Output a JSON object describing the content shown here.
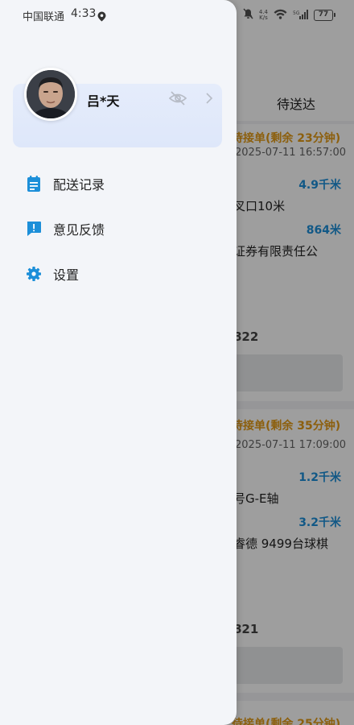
{
  "status_bar": {
    "carrier": "中国联通",
    "time": "4:33",
    "net_speed_top": "4.4",
    "net_speed_bottom": "K/s",
    "battery": "77"
  },
  "profile": {
    "name": "吕*天"
  },
  "menu": {
    "items": [
      {
        "label": "配送记录",
        "icon": "delivery-record-icon"
      },
      {
        "label": "意见反馈",
        "icon": "feedback-icon"
      },
      {
        "label": "设置",
        "icon": "settings-icon"
      }
    ]
  },
  "background": {
    "tab_label": "待送达",
    "orders": [
      {
        "status": "待接单(剩余 23分钟)",
        "time": "2025-07-11 16:57:00",
        "pickup_distance": "4.9千米",
        "pickup_address": "叉口10米",
        "dropoff_distance": "864米",
        "dropoff_address": "证券有限责任公",
        "code": "822"
      },
      {
        "status": "待接单(剩余 35分钟)",
        "time": "2025-07-11 17:09:00",
        "pickup_distance": "1.2千米",
        "pickup_address": "号G-E轴",
        "dropoff_distance": "3.2千米",
        "dropoff_address": "睿德 9499台球棋",
        "code": "821"
      },
      {
        "status": "待接单(剩余 25分钟)"
      }
    ]
  },
  "colors": {
    "accent": "#1c8fd9",
    "status_orange": "#e39a16",
    "drawer_bg": "#f3f5f9"
  }
}
